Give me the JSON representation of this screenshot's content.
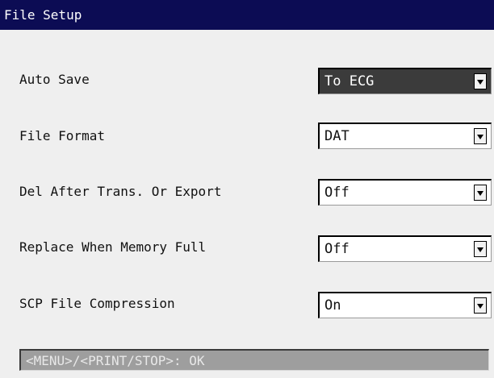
{
  "window": {
    "title": "File Setup"
  },
  "settings": [
    {
      "label": "Auto Save",
      "value": "To ECG",
      "highlighted": true
    },
    {
      "label": "File Format",
      "value": "DAT",
      "highlighted": false
    },
    {
      "label": "Del After Trans. Or Export",
      "value": "Off",
      "highlighted": false
    },
    {
      "label": "Replace When Memory Full",
      "value": "Off",
      "highlighted": false
    },
    {
      "label": "SCP File Compression",
      "value": "On",
      "highlighted": false
    }
  ],
  "status": {
    "text": "<MENU>/<PRINT/STOP>: OK"
  },
  "colors": {
    "titlebar": "#0c0c54",
    "background": "#efefef",
    "highlighted_select": "#3b3b3b",
    "status_bar": "#9e9e9e"
  }
}
